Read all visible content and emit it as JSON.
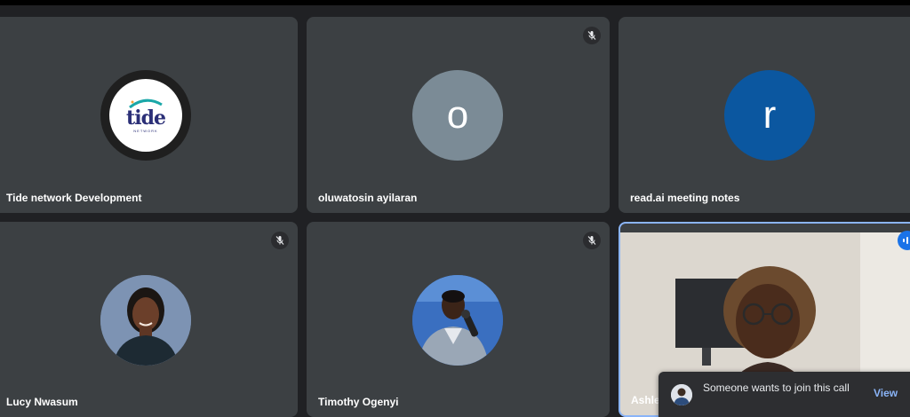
{
  "participants": [
    {
      "name": "Tide network Development",
      "avatar_type": "logo",
      "logo_text": "tide",
      "logo_subtext": "NETWORK",
      "muted": false
    },
    {
      "name": "oluwatosin ayilaran",
      "avatar_type": "letter",
      "letter": "o",
      "avatar_color": "#7b8b96",
      "muted": true
    },
    {
      "name": "read.ai meeting notes",
      "avatar_type": "letter",
      "letter": "r",
      "avatar_color": "#0b57a0",
      "muted": false
    },
    {
      "name": "Lucy Nwasum",
      "avatar_type": "photo",
      "muted": true
    },
    {
      "name": "Timothy Ogenyi",
      "avatar_type": "photo",
      "muted": true
    },
    {
      "name": "Ashley",
      "avatar_type": "video",
      "muted": false,
      "speaking": true
    }
  ],
  "join_toast": {
    "message": "Someone wants to join this call",
    "action_label": "View"
  },
  "colors": {
    "background": "#202124",
    "tile": "#3c4043",
    "accent": "#8ab4f8",
    "speaking": "#1a73e8"
  },
  "icons": {
    "muted": "mic-off-icon",
    "speaking": "audio-bars-icon"
  }
}
